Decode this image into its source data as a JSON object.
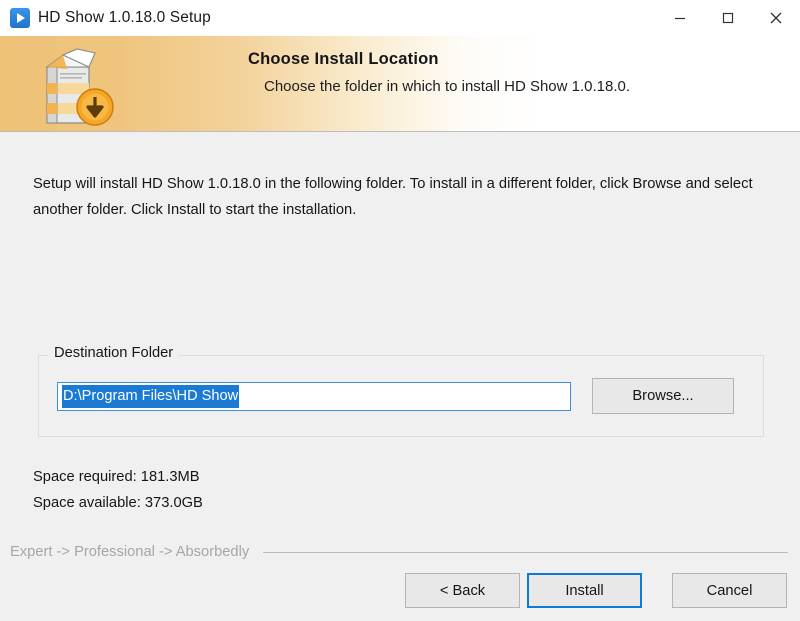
{
  "titlebar": {
    "app_icon": "play-button-icon",
    "title": "HD Show 1.0.18.0 Setup",
    "minimize_label": "Minimize",
    "maximize_label": "Maximize",
    "close_label": "Close"
  },
  "header": {
    "icon": "install-package-icon",
    "title": "Choose Install Location",
    "subtitle": "Choose the folder in which to install HD Show 1.0.18.0.",
    "gradient_start": "#eec277",
    "gradient_end": "#ffffff"
  },
  "body": {
    "intro": "Setup will install HD Show 1.0.18.0 in the following folder. To install in a different folder, click Browse and select another folder. Click Install to start the installation.",
    "group_label": "Destination Folder",
    "path_value": "D:\\Program Files\\HD Show",
    "path_placeholder": "D:\\Program Files\\HD Show",
    "path_selected": true,
    "selection_color": "#1a7ad4",
    "browse_label": "Browse...",
    "space_required": "Space required: 181.3MB",
    "space_available": "Space available: 373.0GB"
  },
  "footer": {
    "brand_text": "Expert -> Professional -> Absorbedly",
    "buttons": [
      {
        "label": "< Back",
        "primary": false
      },
      {
        "label": "Install",
        "primary": true
      },
      {
        "label": "Cancel",
        "primary": false
      }
    ]
  }
}
